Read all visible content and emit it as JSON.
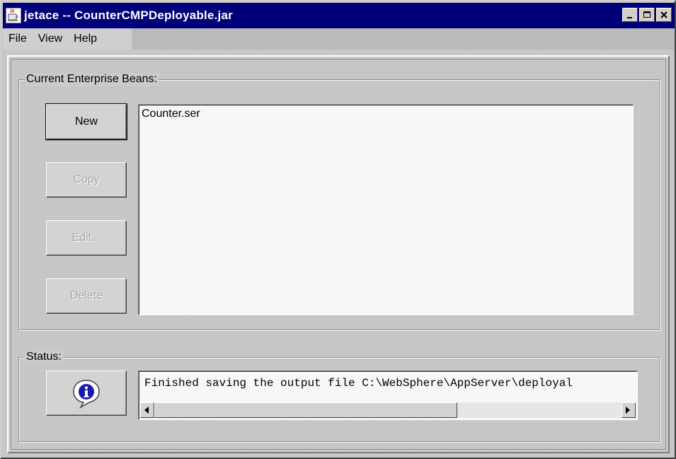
{
  "window": {
    "title": "jetace -- CounterCMPDeployable.jar",
    "controls": {
      "minimize": "_",
      "maximize": "□",
      "close": "×"
    }
  },
  "menu": {
    "items": [
      {
        "label": "File"
      },
      {
        "label": "View"
      },
      {
        "label": "Help"
      }
    ]
  },
  "beans_group": {
    "label": "Current Enterprise Beans:",
    "buttons": {
      "new": "New",
      "copy": "Copy",
      "edit": "Edit...",
      "delete": "Delete"
    },
    "list": [
      "Counter.ser"
    ]
  },
  "status_group": {
    "label": "Status:",
    "info_icon": "info-icon",
    "message": "Finished saving the output file C:\\WebSphere\\AppServer\\deployal"
  },
  "colors": {
    "titlebar": "#00007b",
    "face": "#c7c7c7",
    "list_bg": "#f7f7f7"
  }
}
